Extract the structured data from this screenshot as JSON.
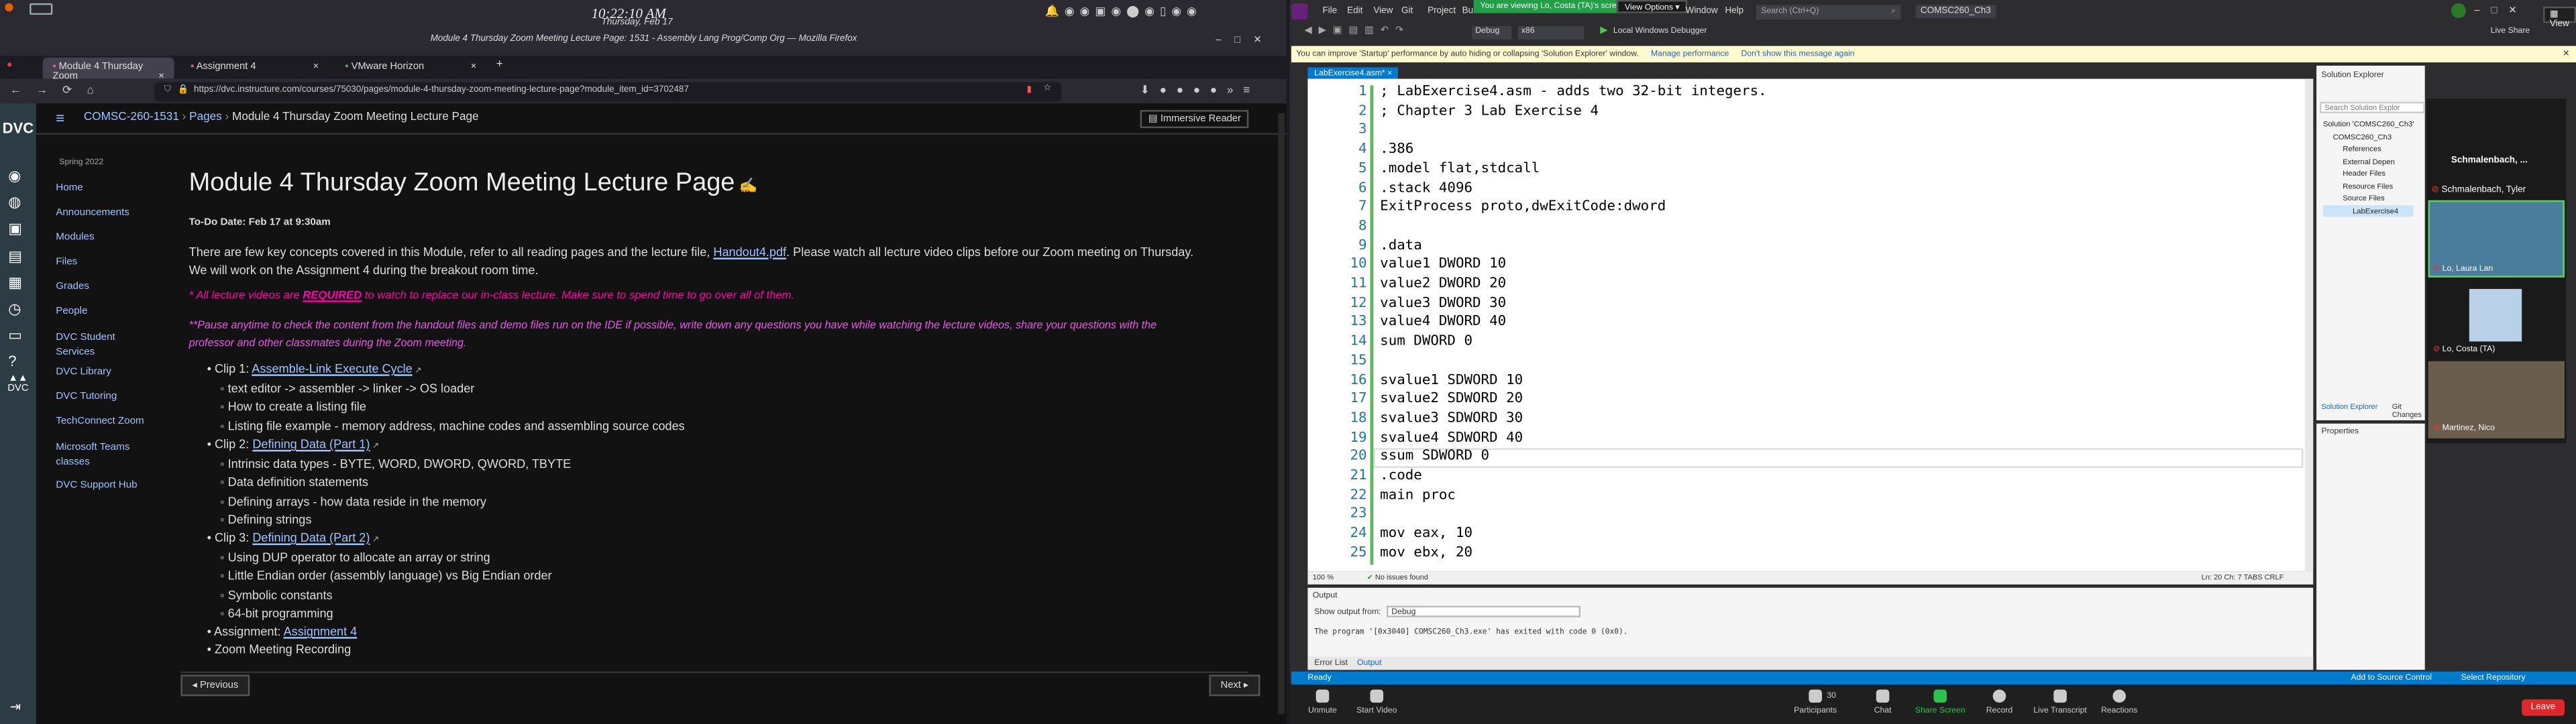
{
  "left": {
    "clock_time": "10:22:10 AM",
    "clock_date": "Thursday, Feb 17",
    "window_title": "Module 4 Thursday Zoom Meeting Lecture Page: 1531 - Assembly Lang Prog/Comp Org — Mozilla Firefox",
    "tabs": [
      "Module 4 Thursday Zoom",
      "Assignment 4",
      "VMware Horizon"
    ],
    "url": "https://dvc.instructure.com/courses/75030/pages/module-4-thursday-zoom-meeting-lecture-page?module_item_id=3702487",
    "breadcrumb": [
      "COMSC-260-1531",
      "Pages",
      "Module 4 Thursday Zoom Meeting Lecture Page"
    ],
    "immersive": "Immersive Reader",
    "term": "Spring 2022",
    "nav": [
      "Home",
      "Announcements",
      "Modules",
      "Files",
      "Grades",
      "People",
      "DVC Student Services",
      "DVC Library",
      "DVC Tutoring",
      "TechConnect Zoom",
      "Microsoft Teams classes",
      "DVC Support Hub"
    ],
    "page_title": "Module 4 Thursday Zoom Meeting Lecture Page",
    "todo": "To-Do Date: Feb 17 at 9:30am",
    "intro1": "There are few key concepts covered in this Module, refer to all reading pages and the lecture file, ",
    "intro_link": "Handout4.pdf",
    "intro2": ". Please watch all lecture video clips before our Zoom meeting on Thursday.",
    "intro3": "We will work on the Assignment 4 during the breakout room time.",
    "required_a": "* All lecture videos are ",
    "required_b": "REQUIRED",
    "required_c": " to watch to replace our in-class lecture. Make sure to spend time to go over all of them.",
    "pause1": "**Pause anytime to check the content from the handout files and demo files run on the IDE if possible, write down any questions you have while watching the lecture videos, share your questions with the",
    "pause2": "professor and other classmates during the Zoom meeting.",
    "clip1_label": "Clip 1: ",
    "clip1_link": "Assemble-Link Execute Cycle",
    "clip1_items": [
      "text editor -> assembler -> linker -> OS loader",
      "How to create a listing file",
      "Listing file example - memory address, machine codes and assembling source codes"
    ],
    "clip2_label": "Clip 2: ",
    "clip2_link": "Defining Data (Part 1)",
    "clip2_items": [
      "Intrinsic data types - BYTE, WORD, DWORD, QWORD, TBYTE",
      "Data definition statements",
      "Defining arrays - how data reside in the memory",
      "Defining strings"
    ],
    "clip3_label": "Clip 3: ",
    "clip3_link": "Defining Data (Part 2)",
    "clip3_items": [
      "Using DUP operator to allocate an array or string",
      "Little Endian order (assembly language) vs Big Endian order",
      "Symbolic constants",
      "64-bit programming"
    ],
    "assign_label": "Assignment: ",
    "assign_link": "Assignment 4",
    "zoom_rec": "Zoom Meeting Recording",
    "prev": "◂ Previous",
    "next": "Next ▸"
  },
  "right": {
    "menu": [
      "File",
      "Edit",
      "View",
      "Git",
      "Project",
      "Build"
    ],
    "menu2": [
      "Window",
      "Help"
    ],
    "share_banner": "You are viewing Lo, Costa (TA)'s screen",
    "view_options": "View Options",
    "search": "Search (Ctrl+Q)",
    "solution_name": "COMSC260_Ch3",
    "config": "Debug",
    "platform": "x86",
    "debugger": "Local Windows Debugger",
    "live_share": "Live Share",
    "view_btn": "View",
    "info_bar": "You can improve 'Startup' performance by auto hiding or collapsing 'Solution Explorer' window.",
    "manage_perf": "Manage performance",
    "dont_show": "Don't show this message again",
    "file_tab": "LabExercise4.asm*",
    "code_lines": [
      "; LabExercise4.asm - adds two 32-bit integers.",
      "; Chapter 3 Lab Exercise 4",
      "",
      ".386",
      ".model flat,stdcall",
      ".stack 4096",
      "ExitProcess proto,dwExitCode:dword",
      "",
      ".data",
      "value1 DWORD 10",
      "value2 DWORD 20",
      "value3 DWORD 30",
      "value4 DWORD 40",
      "sum DWORD 0",
      "",
      "svalue1 SDWORD 10",
      "svalue2 SDWORD 20",
      "svalue3 SDWORD 30",
      "svalue4 SDWORD 40",
      "ssum SDWORD 0",
      ".code",
      "main proc",
      "",
      "mov eax, 10",
      "mov ebx, 20"
    ],
    "zoom_level": "100 %",
    "no_issues": "No issues found",
    "pos": "Ln: 20   Ch: 7   TABS   CRLF",
    "se_title": "Solution Explorer",
    "se_search": "Search Solution Explor",
    "se_items": [
      "Solution 'COMSC260_Ch3'",
      "COMSC260_Ch3",
      "References",
      "External Depen",
      "Header Files",
      "Resource Files",
      "Source Files",
      "LabExercise4"
    ],
    "se_tabs": [
      "Solution Explorer",
      "Git Changes"
    ],
    "props": "Properties",
    "output_title": "Output",
    "show_from": "Show output from:",
    "output_src": "Debug",
    "output_line": "The program '[0x3040] COMSC260_Ch3.exe' has exited with code 0 (0x0).",
    "bottom_tabs": [
      "Error List",
      "Output"
    ],
    "status": "Ready",
    "add_src": "Add to Source Control",
    "select_repo": "Select Repository",
    "participants_self": "Schmalenbach, ...",
    "participants": [
      "Schmalenbach, Tyler",
      "Lo, Laura Lan",
      "Lo, Costa (TA)",
      "Martinez, Nico"
    ],
    "tb": [
      "Unmute",
      "Start Video",
      "Participants",
      "Chat",
      "Share Screen",
      "Record",
      "Live Transcript",
      "Reactions"
    ],
    "participant_count": "30",
    "leave": "Leave"
  }
}
